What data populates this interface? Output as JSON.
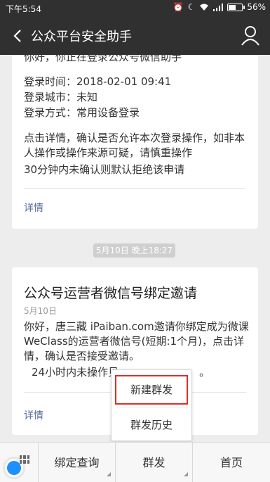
{
  "status_bar": {
    "time": "下午5:54",
    "battery": "56%",
    "battery_level": 0.56
  },
  "nav": {
    "title": "公众平台安全助手",
    "back_icon": "back-arrow-icon",
    "profile_icon": "person-icon"
  },
  "card1": {
    "cut_line": "你好，你正在登录公众号微信助手",
    "login_time": "登录时间：2018-02-01 09:41",
    "login_city": "登录城市：未知",
    "login_method": "登录方式：常用设备登录",
    "body": "点击详情，确认是否允许本次登录操作，如非本人操作或操作来源可疑，请慎重操作",
    "note": "30分钟内未确认则默认拒绝该申请",
    "details_link": "详情"
  },
  "timestamp": "5月10日 晚上18:27",
  "card2": {
    "title": "公众号运营者微信号绑定邀请",
    "date": "5月10日",
    "body": "你好，唐三藏 iPaiban.com邀请你绑定成为微课WeClass的运营者微信号(短期:1个月)，点击详情，确认是否接受邀请。",
    "note_prefix": "24小时内未操作贝",
    "note_suffix": "。",
    "details_link": "详情"
  },
  "popup": {
    "items": [
      "新建群发",
      "群发历史"
    ],
    "highlight_color": "#d9302a"
  },
  "bottom_menu": {
    "items": [
      "绑定查询",
      "群发",
      "首页"
    ]
  }
}
